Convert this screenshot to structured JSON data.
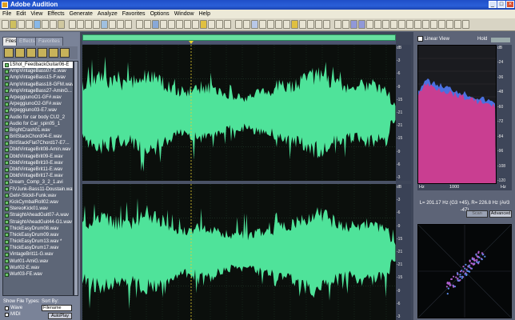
{
  "window": {
    "title": "Adobe Audition",
    "buttons": [
      "_",
      "□",
      "×"
    ]
  },
  "menu": [
    "File",
    "Edit",
    "View",
    "Effects",
    "Generate",
    "Analyze",
    "Favorites",
    "Options",
    "Window",
    "Help"
  ],
  "tabs": [
    "Files",
    "Effects",
    "Favorites"
  ],
  "files": [
    "1Shot_FeedbackGuitar06-E",
    "AmpVintageBass07-E.wav",
    "AmpVintageBass15-F.wav",
    "AmpVintageBass18-GFM.wav",
    "AmpVintageBass27-AminG...",
    "ArpeggiunoO1-GF#.wav",
    "ArpeggiunoO2-GF#.wav",
    "Arpeggiuno03-E7.wav",
    "Audio for car body CU2_2",
    "Audio for Car_spin05_1",
    "BrightCrash01.wav",
    "BritStackChord04-E.wav",
    "BritStackFlat7Chord17-E7...",
    "DbldVintageBrit08-Amin.wav",
    "DbldVintageBrit09-E.wav",
    "DbldVintageBrit10-E.wav",
    "DbldVintageBrit11-E.wav",
    "DbldVintageBrit17-E.wav",
    "Dream_Comp_3_2_1.avi",
    "FIVJunk-Bass11-Doustain.wav",
    "Get#-Stickll-Funk.wav",
    "KickCymbalRoll02.wav",
    "StereoKick01.wav",
    "StraightAheadGuit07-A.wav",
    "StraightAheadGuit44-G1.wav",
    "ThickEasyDrum08.wav",
    "ThickEasyDrum09.wav",
    "ThickEasyDrum13.wav *",
    "ThickEasyDrum17.wav",
    "VintageBrit11-G.wav",
    "Wurl01-AmiG.wav",
    "Wurl02-E.wav",
    "Wurl03-FE.wav"
  ],
  "selected_file_index": 0,
  "file_types": {
    "label": "Show File Types:",
    "items": [
      "Wave",
      "MIDI"
    ]
  },
  "sort_by": {
    "label": "Sort By:",
    "value": "Filename"
  },
  "autoplay_label": "AutoPlay",
  "db_scale_top": [
    "dB",
    "-3",
    "-6",
    "-9",
    "-15",
    "-21",
    "-21",
    "-15",
    "-9",
    "-6",
    "-3"
  ],
  "db_scale_bottom": [
    "dB",
    "-3",
    "-6",
    "-9",
    "-15",
    "-21",
    "-21",
    "-15",
    "-9",
    "-6",
    "-3"
  ],
  "analysis": {
    "view_label": "Linear View",
    "hold_label": "Hold",
    "scale": [
      "dB",
      "-24",
      "-36",
      "-48",
      "-60",
      "-72",
      "-84",
      "-96",
      "-108",
      "-120"
    ],
    "freq_axis": [
      "Hz",
      "1000",
      "Hz"
    ],
    "readout": "L= 201.17 Hz (G3 +45), R= 226.8 Hz (A#3 -47)",
    "apply_label": "Scan",
    "advanced_label": "Advanced"
  },
  "colors": {
    "waveform": "#4fe39a",
    "spectrum_left": "#d43a8a",
    "spectrum_right": "#4a70e0",
    "title_bar": "#2a5fd8"
  }
}
